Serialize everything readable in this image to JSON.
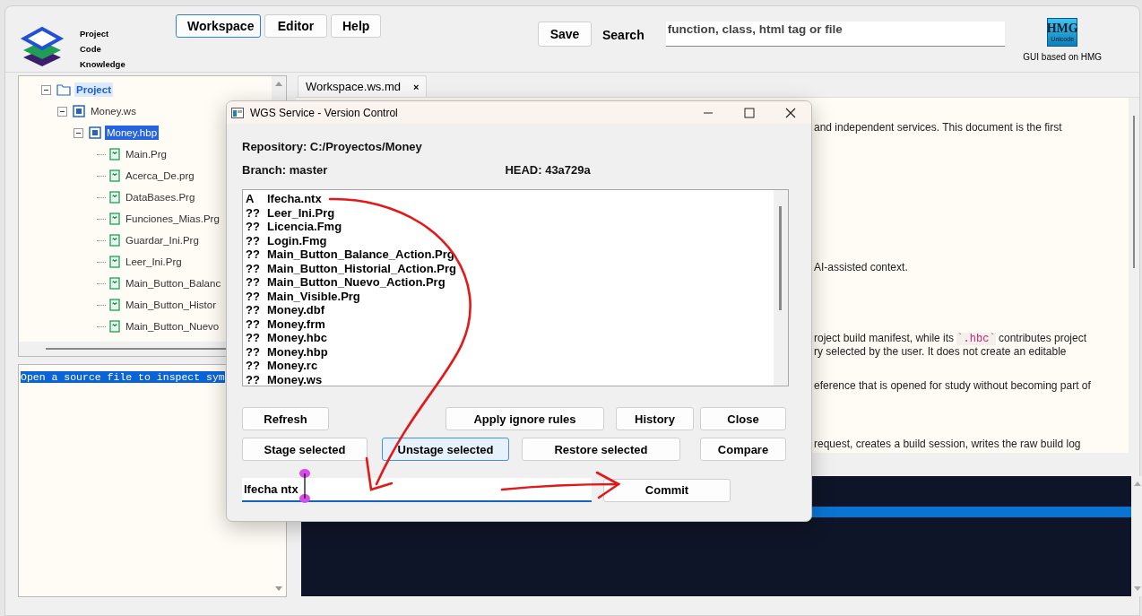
{
  "brand": {
    "lines": [
      "Project",
      "Code",
      "Knowledge"
    ]
  },
  "nav": [
    {
      "label": "Workspace",
      "selected": true
    },
    {
      "label": "Editor",
      "selected": false
    },
    {
      "label": "Help",
      "selected": false
    }
  ],
  "save_button": "Save",
  "search": {
    "label": "Search",
    "placeholder": "function, class, html tag or file"
  },
  "hmg": {
    "logo": "HMG",
    "logo_sub": "Unicode",
    "caption": "GUI based on HMG"
  },
  "tree": [
    {
      "label": "Project",
      "kind": "folder",
      "selected": false,
      "highlighted": true,
      "expanded": true,
      "children": [
        {
          "label": "Money.ws",
          "kind": "workspace",
          "selected": false,
          "highlighted": false,
          "expanded": true,
          "children": [
            {
              "label": "Money.hbp",
              "kind": "project",
              "selected": true,
              "highlighted": false,
              "expanded": true,
              "children": [
                {
                  "label": "Main.Prg",
                  "kind": "file",
                  "selected": false,
                  "highlighted": false
                },
                {
                  "label": "Acerca_De.prg",
                  "kind": "file",
                  "selected": false,
                  "highlighted": false
                },
                {
                  "label": "DataBases.Prg",
                  "kind": "file",
                  "selected": false,
                  "highlighted": false
                },
                {
                  "label": "Funciones_Mias.Prg",
                  "kind": "file",
                  "selected": false,
                  "highlighted": false
                },
                {
                  "label": "Guardar_Ini.Prg",
                  "kind": "file",
                  "selected": false,
                  "highlighted": false
                },
                {
                  "label": "Leer_Ini.Prg",
                  "kind": "file",
                  "selected": false,
                  "highlighted": false
                },
                {
                  "label": "Main_Button_Balanc",
                  "kind": "file",
                  "selected": false,
                  "highlighted": false
                },
                {
                  "label": "Main_Button_Histor",
                  "kind": "file",
                  "selected": false,
                  "highlighted": false
                },
                {
                  "label": "Main_Button_Nuevo",
                  "kind": "file",
                  "selected": false,
                  "highlighted": false
                }
              ]
            }
          ]
        }
      ]
    }
  ],
  "symbols_panel": {
    "message": "Open a source file to inspect sym"
  },
  "editor_tab": {
    "label": "Workspace.ws.md",
    "close": "×"
  },
  "document": [
    {
      "lines": [
        [
          {
            "text": "and independent services. This document is the first"
          }
        ]
      ]
    },
    {
      "lines": [
        [
          {
            "text": "AI-assisted context."
          }
        ]
      ]
    },
    {
      "lines": [
        [
          {
            "text": "roject build manifest, while its "
          },
          {
            "text": "`.hbc`",
            "kind": "code"
          },
          {
            "text": " contributes project"
          }
        ],
        [
          {
            "text": "ry selected by the user. It does not create an editable"
          }
        ]
      ]
    },
    {
      "lines": [
        [
          {
            "text": "eference that is opened for study without becoming part of"
          }
        ]
      ]
    },
    {
      "lines": [
        [
          {
            "text": "request, creates a build session, writes the raw build log"
          }
        ]
      ]
    }
  ],
  "dialog": {
    "title": "WGS Service - Version Control",
    "repository": "Repository: C:/Proyectos/Money",
    "branch": "Branch: master",
    "head": "HEAD: 43a729a",
    "files": [
      {
        "status": "A",
        "name": "lfecha.ntx"
      },
      {
        "status": "??",
        "name": "Leer_Ini.Prg"
      },
      {
        "status": "??",
        "name": "Licencia.Fmg"
      },
      {
        "status": "??",
        "name": "Login.Fmg"
      },
      {
        "status": "??",
        "name": "Main_Button_Balance_Action.Prg"
      },
      {
        "status": "??",
        "name": "Main_Button_Historial_Action.Prg"
      },
      {
        "status": "??",
        "name": "Main_Button_Nuevo_Action.Prg"
      },
      {
        "status": "??",
        "name": "Main_Visible.Prg"
      },
      {
        "status": "??",
        "name": "Money.dbf"
      },
      {
        "status": "??",
        "name": "Money.frm"
      },
      {
        "status": "??",
        "name": "Money.hbc"
      },
      {
        "status": "??",
        "name": "Money.hbp"
      },
      {
        "status": "??",
        "name": "Money.rc"
      },
      {
        "status": "??",
        "name": "Money.ws"
      }
    ],
    "button_rows": [
      [
        {
          "label": "Refresh",
          "focused": false
        },
        {
          "label": "Apply ignore rules",
          "focused": false
        },
        {
          "label": "History",
          "focused": false
        },
        {
          "label": "Close",
          "focused": false
        }
      ],
      [
        {
          "label": "Stage selected",
          "focused": false
        },
        {
          "label": "Unstage selected",
          "focused": true
        },
        {
          "label": "Restore selected",
          "focused": false
        },
        {
          "label": "Compare",
          "focused": false
        }
      ]
    ],
    "commit_message": "lfecha ntx",
    "commit_button": "Commit"
  }
}
